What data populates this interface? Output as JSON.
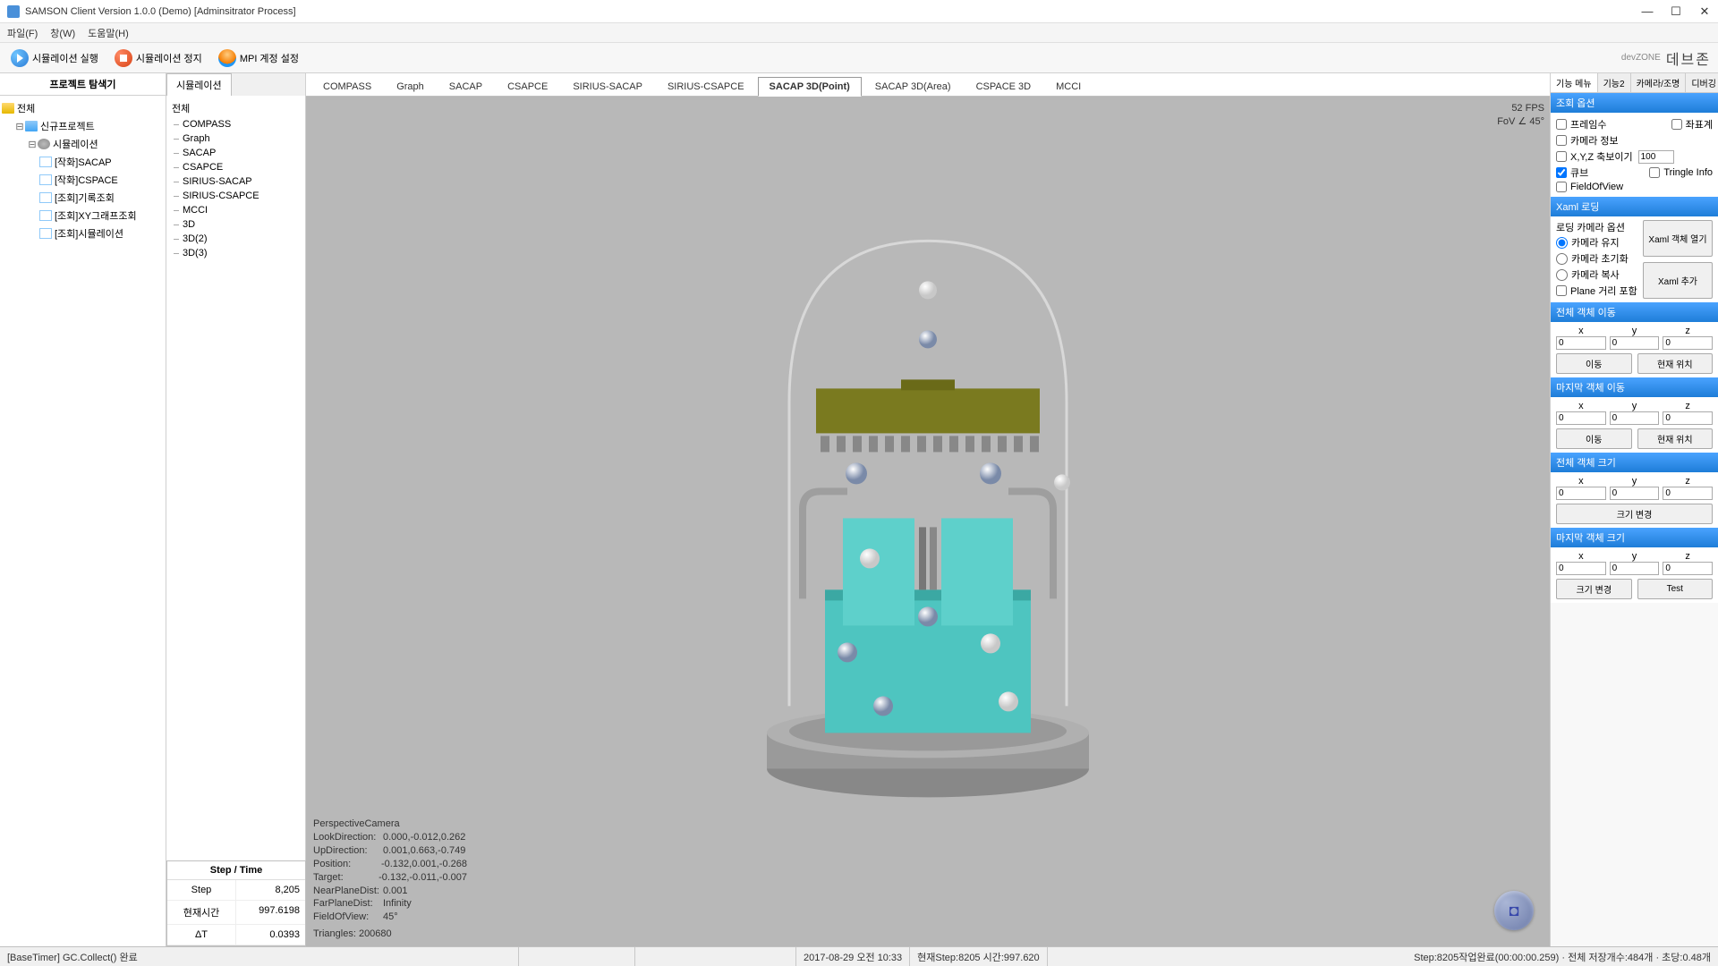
{
  "window": {
    "title": "SAMSON Client Version 1.0.0 (Demo) [Adminsitrator Process]"
  },
  "menu": {
    "file": "파일(F)",
    "window": "창(W)",
    "help": "도움말(H)"
  },
  "toolbar": {
    "run": "시뮬레이션 실행",
    "stop": "시뮬레이션 정지",
    "mpi": "MPI 계정 설정",
    "logo_small": "devZONE",
    "logo_kr": "데브존"
  },
  "project_explorer": {
    "title": "프로젝트 탐색기",
    "root": "전체",
    "project": "신규프로젝트",
    "sim": "시뮬레이션",
    "items": [
      "[작화]SACAP",
      "[작화]CSPACE",
      "[조회]기록조회",
      "[조회]XY그래프조회",
      "[조회]시뮬레이션"
    ]
  },
  "sim_panel": {
    "tab": "시뮬레이션",
    "root": "전체",
    "items": [
      "COMPASS",
      "Graph",
      "SACAP",
      "CSAPCE",
      "SIRIUS-SACAP",
      "SIRIUS-CSAPCE",
      "MCCI",
      "3D",
      "3D(2)",
      "3D(3)"
    ]
  },
  "view_tabs": [
    "COMPASS",
    "Graph",
    "SACAP",
    "CSAPCE",
    "SIRIUS-SACAP",
    "SIRIUS-CSAPCE",
    "SACAP 3D(Point)",
    "SACAP 3D(Area)",
    "CSPACE 3D",
    "MCCI"
  ],
  "view_active": "SACAP 3D(Point)",
  "hud": {
    "fps": "52 FPS",
    "fov": "FoV ∠ 45°"
  },
  "camera_info": {
    "cam": "PerspectiveCamera",
    "look": "0.000,-0.012,0.262",
    "up": "0.001,0.663,-0.749",
    "pos": "-0.132,0.001,-0.268",
    "target": "-0.132,-0.011,-0.007",
    "near": "0.001",
    "far": "Infinity",
    "fov": "45°",
    "tris": "Triangles: 200680",
    "lbl_look": "LookDirection:",
    "lbl_up": "UpDirection:",
    "lbl_pos": "Position:",
    "lbl_target": "Target:",
    "lbl_near": "NearPlaneDist:",
    "lbl_far": "FarPlaneDist:",
    "lbl_fov": "FieldOfView:"
  },
  "step": {
    "title": "Step / Time",
    "step_lbl": "Step",
    "step_val": "8,205",
    "time_lbl": "현재시간",
    "time_val": "997.6198",
    "dt_lbl": "ΔT",
    "dt_val": "0.0393"
  },
  "right": {
    "tabs": [
      "기능 메뉴",
      "기능2",
      "카메라/조명",
      "디버깅 정"
    ],
    "sec_view": "조회 옵션",
    "chk_frame": "프레임수",
    "chk_coord": "좌표계",
    "chk_caminfo": "카메라 정보",
    "chk_xyz": "X,Y,Z 축보이기",
    "xyz_val": "100",
    "chk_cube": "큐브",
    "chk_tri": "Tringle Info",
    "chk_fov": "FieldOfView",
    "sec_xaml": "Xaml 로딩",
    "xaml_lbl": "로딩 카메라 옵션",
    "r_keep": "카메라 유지",
    "r_reset": "카메라 초기화",
    "r_copy": "카메라 복사",
    "chk_plane": "Plane 거리 포함",
    "btn_xaml_open": "Xaml 객체 열기",
    "btn_xaml_add": "Xaml 추가",
    "sec_move_all": "전체 객체 이동",
    "sec_move_last": "마지막 객체 이동",
    "sec_size_all": "전체 객체 크기",
    "sec_size_last": "마지막 객체 크기",
    "x": "x",
    "y": "y",
    "z": "z",
    "btn_move": "이동",
    "btn_curpos": "현재 위치",
    "btn_resize": "크기 변경",
    "btn_test": "Test",
    "zero": "0"
  },
  "status": {
    "left": "[BaseTimer] GC.Collect() 완료",
    "time": "2017-08-29 오전 10:33",
    "step": "현재Step:8205 시간:997.620",
    "right": "Step:8205작업완료(00:00:00.259) · 전체 저장개수:484개 · 초당:0.48개"
  }
}
